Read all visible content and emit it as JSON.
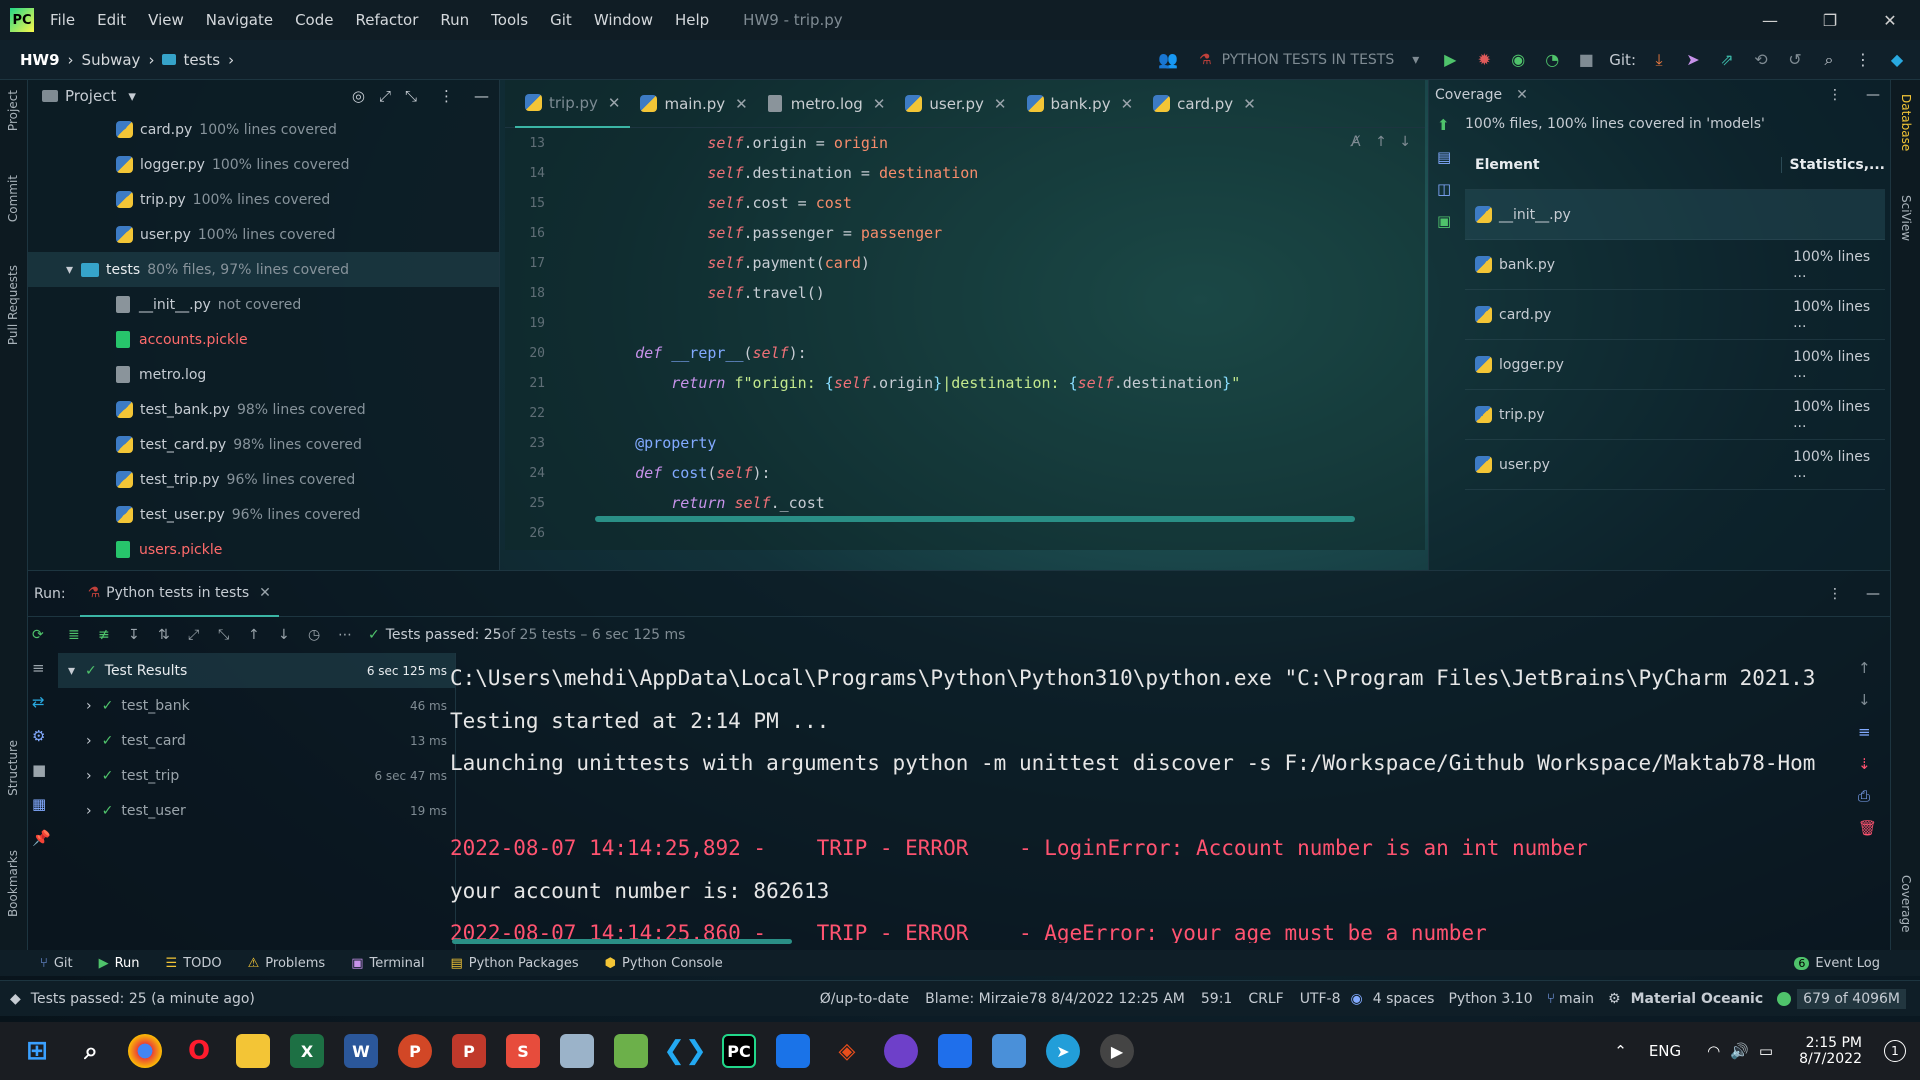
{
  "titlebar": {
    "menu": [
      "File",
      "Edit",
      "View",
      "Navigate",
      "Code",
      "Refactor",
      "Run",
      "Tools",
      "Git",
      "Window",
      "Help"
    ],
    "title": "HW9 - trip.py"
  },
  "navbar": {
    "crumbs": [
      "HW9",
      "Subway",
      "tests"
    ],
    "run_config": "PYTHON TESTS IN TESTS",
    "git_label": "Git:"
  },
  "project": {
    "title": "Project",
    "items": [
      {
        "name": "card.py",
        "cov": "100% lines covered",
        "kind": "py",
        "indent": 1,
        "color": "#c6ccd3"
      },
      {
        "name": "logger.py",
        "cov": "100% lines covered",
        "kind": "py",
        "indent": 1,
        "color": "#c6ccd3"
      },
      {
        "name": "trip.py",
        "cov": "100% lines covered",
        "kind": "py",
        "indent": 1,
        "color": "#c6ccd3"
      },
      {
        "name": "user.py",
        "cov": "100% lines covered",
        "kind": "py",
        "indent": 1,
        "color": "#c6ccd3"
      },
      {
        "name": "tests",
        "cov": "80% files, 97% lines covered",
        "kind": "folder",
        "indent": 0,
        "color": "#e8ecef"
      },
      {
        "name": "__init__.py",
        "cov": "not covered",
        "kind": "file",
        "indent": 1,
        "color": "#c6ccd3"
      },
      {
        "name": "accounts.pickle",
        "cov": "",
        "kind": "pickle",
        "indent": 1,
        "color": "#ff6b6b"
      },
      {
        "name": "metro.log",
        "cov": "",
        "kind": "file",
        "indent": 1,
        "color": "#c6ccd3"
      },
      {
        "name": "test_bank.py",
        "cov": "98% lines covered",
        "kind": "py",
        "indent": 1,
        "color": "#c6ccd3"
      },
      {
        "name": "test_card.py",
        "cov": "98% lines covered",
        "kind": "py",
        "indent": 1,
        "color": "#c6ccd3"
      },
      {
        "name": "test_trip.py",
        "cov": "96% lines covered",
        "kind": "py",
        "indent": 1,
        "color": "#c6ccd3"
      },
      {
        "name": "test_user.py",
        "cov": "96% lines covered",
        "kind": "py",
        "indent": 1,
        "color": "#c6ccd3"
      },
      {
        "name": "users.pickle",
        "cov": "",
        "kind": "pickle",
        "indent": 1,
        "color": "#ff6b6b"
      }
    ]
  },
  "editor": {
    "tabs": [
      {
        "label": "trip.py",
        "active": true
      },
      {
        "label": "main.py"
      },
      {
        "label": "metro.log"
      },
      {
        "label": "user.py"
      },
      {
        "label": "bank.py"
      },
      {
        "label": "card.py"
      }
    ],
    "lines": [
      {
        "n": "13",
        "html": "            <span class='sf'>self</span>.origin = <span class='va'>origin</span>"
      },
      {
        "n": "14",
        "html": "            <span class='sf'>self</span>.destination = <span class='va'>destination</span>"
      },
      {
        "n": "15",
        "html": "            <span class='sf'>self</span>.cost = <span class='va'>cost</span>"
      },
      {
        "n": "16",
        "html": "            <span class='sf'>self</span>.passenger = <span class='va'>passenger</span>"
      },
      {
        "n": "17",
        "html": "            <span class='sf'>self</span>.payment(<span class='va'>card</span>)"
      },
      {
        "n": "18",
        "html": "            <span class='sf'>self</span>.travel()"
      },
      {
        "n": "19",
        "html": ""
      },
      {
        "n": "20",
        "html": "    <span class='kw'>def</span> <span class='fn'>__repr__</span>(<span class='sf'>self</span>):"
      },
      {
        "n": "21",
        "html": "        <span class='kw'>return</span> <span class='st'>f\"origin: </span><span class='dc'>{</span><span class='sf'>self</span>.origin<span class='dc'>}</span><span class='st'>|destination: </span><span class='dc'>{</span><span class='sf'>self</span>.destination<span class='dc'>}</span><span class='st'>\"</span>"
      },
      {
        "n": "22",
        "html": ""
      },
      {
        "n": "23",
        "html": "    <span class='fn'>@property</span>"
      },
      {
        "n": "24",
        "html": "    <span class='kw'>def</span> <span class='fn'>cost</span>(<span class='sf'>self</span>):"
      },
      {
        "n": "25",
        "html": "        <span class='kw'>return</span> <span class='sf'>self</span>._cost"
      },
      {
        "n": "26",
        "html": ""
      }
    ]
  },
  "coverage": {
    "title": "Coverage",
    "summary": "100% files, 100% lines covered in 'models'",
    "col_element": "Element",
    "col_stats": "Statistics,...",
    "rows": [
      {
        "name": "__init__.py",
        "stat": ""
      },
      {
        "name": "bank.py",
        "stat": "100% lines ..."
      },
      {
        "name": "card.py",
        "stat": "100% lines ..."
      },
      {
        "name": "logger.py",
        "stat": "100% lines ..."
      },
      {
        "name": "trip.py",
        "stat": "100% lines ..."
      },
      {
        "name": "user.py",
        "stat": "100% lines ..."
      }
    ]
  },
  "run": {
    "label": "Run:",
    "tab": "Python tests in tests",
    "passed_bold": "Tests passed: 25",
    "passed_rest": " of 25 tests – 6 sec 125 ms",
    "results": [
      {
        "name": "Test Results",
        "time": "6 sec 125 ms",
        "root": true
      },
      {
        "name": "test_bank",
        "time": "46 ms"
      },
      {
        "name": "test_card",
        "time": "13 ms"
      },
      {
        "name": "test_trip",
        "time": "6 sec 47 ms"
      },
      {
        "name": "test_user",
        "time": "19 ms"
      }
    ],
    "console": [
      {
        "text": "C:\\Users\\mehdi\\AppData\\Local\\Programs\\Python\\Python310\\python.exe \"C:\\Program Files\\JetBrains\\PyCharm 2021.3",
        "err": false
      },
      {
        "text": "Testing started at 2:14 PM ...",
        "err": false
      },
      {
        "text": "Launching unittests with arguments python -m unittest discover -s F:/Workspace/Github Workspace/Maktab78-Hom",
        "err": false
      },
      {
        "text": "",
        "err": false
      },
      {
        "text": "2022-08-07 14:14:25,892 -    TRIP - ERROR    - LoginError: Account number is an int number",
        "err": true
      },
      {
        "text": "your account number is: 862613",
        "err": false
      },
      {
        "text": "2022-08-07 14:14:25,860 -    TRIP - ERROR    - AgeError: your age must be a number",
        "err": true
      }
    ]
  },
  "toolwin": {
    "items": [
      "Git",
      "Run",
      "TODO",
      "Problems",
      "Terminal",
      "Python Packages",
      "Python Console"
    ],
    "event_log_count": "6",
    "event_log": "Event Log"
  },
  "status": {
    "left": "Tests passed: 25 (a minute ago)",
    "vcs": "Ø/up-to-date",
    "blame": "Blame: Mirzaie78 8/4/2022 12:25 AM",
    "pos": "59:1",
    "crlf": "CRLF",
    "enc": "UTF-8",
    "indent": "4 spaces",
    "python": "Python 3.10",
    "branch": "main",
    "theme": "Material Oceanic",
    "memory": "679 of 4096M"
  },
  "taskbar": {
    "lang": "ENG",
    "time": "2:15 PM",
    "date": "8/7/2022",
    "notif": "1"
  },
  "colors": {
    "accent": "#3bb5a5",
    "error": "#ff5370",
    "pass": "#4fc36b"
  }
}
